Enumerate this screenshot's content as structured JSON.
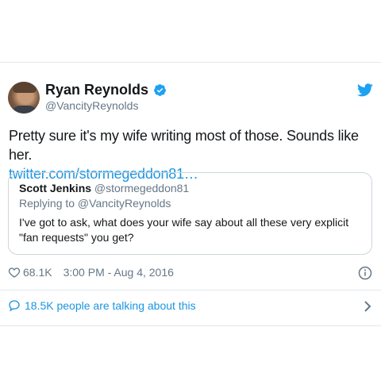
{
  "tweet": {
    "author_name": "Ryan Reynolds",
    "author_handle": "@VancityReynolds",
    "text": "Pretty sure it's my wife writing most of those. Sounds like her.",
    "link": "twitter.com/stormegeddon81…",
    "likes": "68.1K",
    "timestamp": "3:00 PM - Aug 4, 2016",
    "talking": "18.5K people are talking about this"
  },
  "quoted": {
    "author_name": "Scott Jenkins",
    "author_handle": "@stormegeddon81",
    "replying_to": "Replying to @VancityReynolds",
    "text": "I've got to ask, what does your wife say about all these very explicit \"fan requests\" you get?"
  },
  "icons": {
    "verified": "verified-badge-icon",
    "logo": "twitter-bird-icon",
    "like": "heart-icon",
    "info": "info-icon",
    "conversation": "speech-bubble-icon",
    "more": "chevron-right-icon"
  },
  "colors": {
    "accent": "#1b95e0",
    "muted": "#657786",
    "border": "#ccd6dd"
  }
}
